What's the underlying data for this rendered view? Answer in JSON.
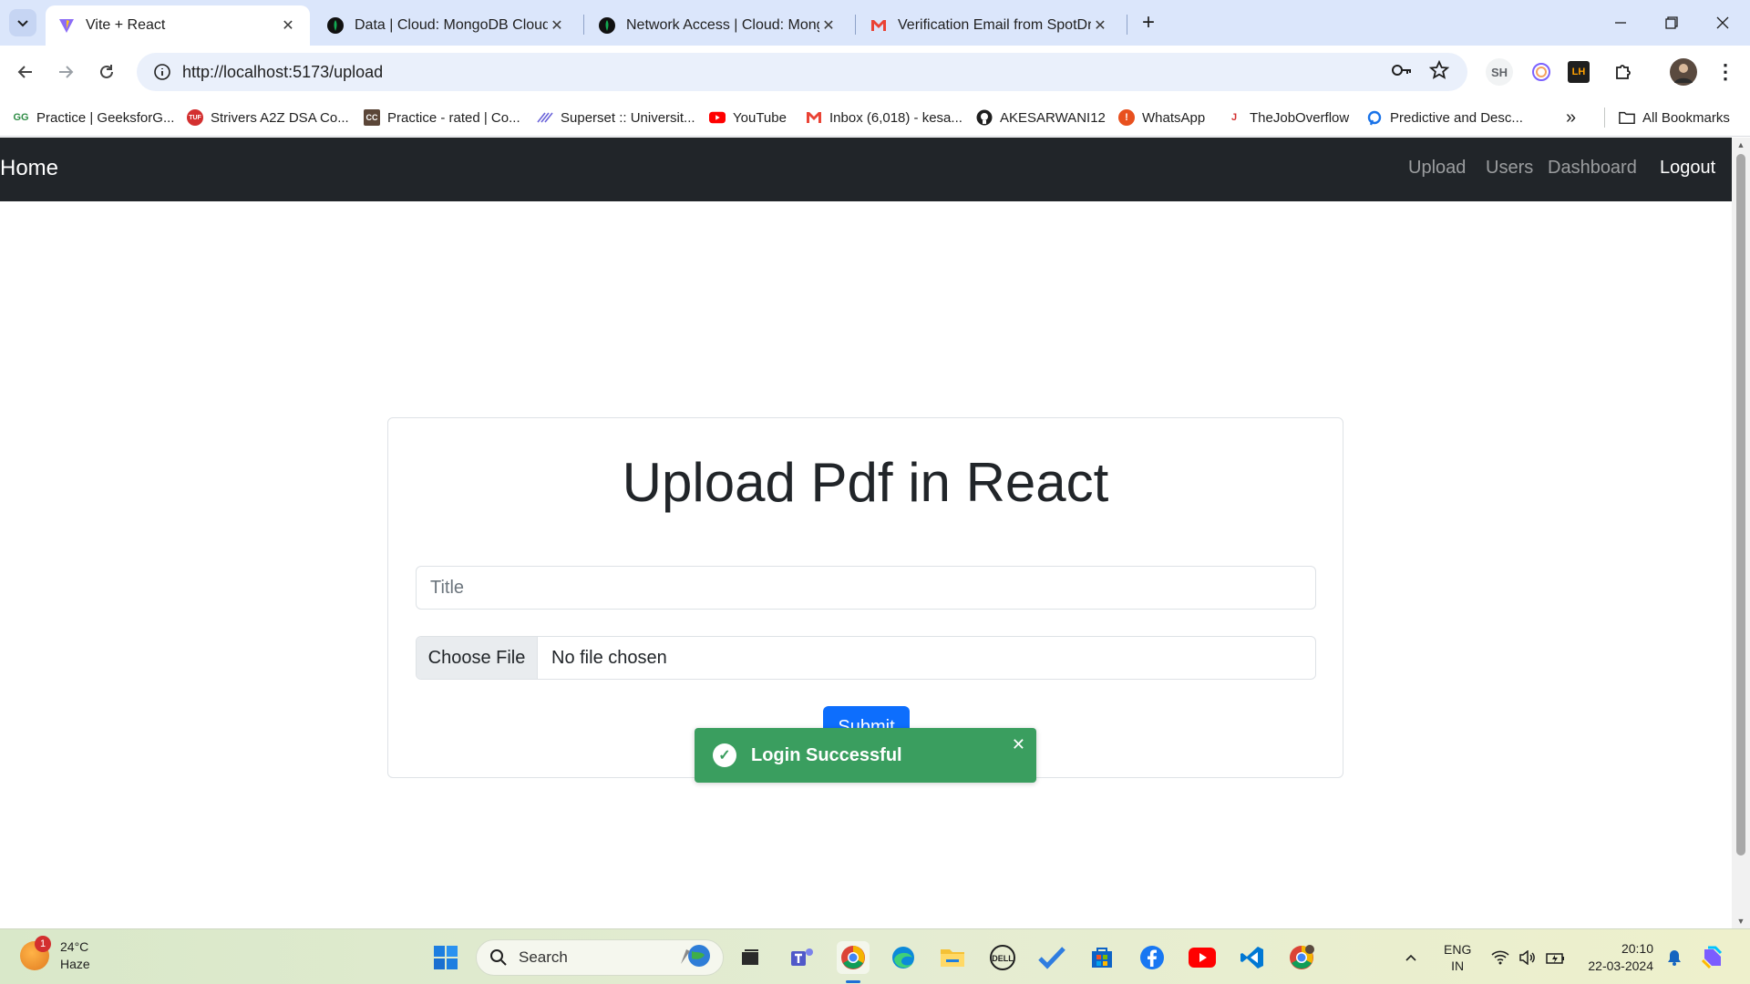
{
  "browser": {
    "tabs": [
      {
        "title": "Vite + React",
        "active": true
      },
      {
        "title": "Data | Cloud: MongoDB Cloud",
        "active": false
      },
      {
        "title": "Network Access | Cloud: Mongo",
        "active": false
      },
      {
        "title": "Verification Email from SpotDra",
        "active": false
      }
    ],
    "url": "http://localhost:5173/upload",
    "profile_ext_label": "SH",
    "ext_lh_label": "LH",
    "bookmarks": [
      {
        "label": "Practice | GeeksforG...",
        "icon": "gfg-icon"
      },
      {
        "label": "Strivers A2Z DSA Co...",
        "icon": "tuf-icon"
      },
      {
        "label": "Practice - rated | Co...",
        "icon": "codechef-icon"
      },
      {
        "label": "Superset :: Universit...",
        "icon": "superset-icon"
      },
      {
        "label": "YouTube",
        "icon": "youtube-icon"
      },
      {
        "label": "Inbox (6,018) - kesa...",
        "icon": "gmail-icon"
      },
      {
        "label": "AKESARWANI12",
        "icon": "github-icon"
      },
      {
        "label": "WhatsApp",
        "icon": "whatsapp-icon"
      },
      {
        "label": "TheJobOverflow",
        "icon": "joboverflow-icon"
      },
      {
        "label": "Predictive and Desc...",
        "icon": "predictive-icon"
      }
    ],
    "all_bookmarks_label": "All Bookmarks"
  },
  "page": {
    "navbar": {
      "brand": "Home",
      "links": [
        "Upload",
        "Users",
        "Dashboard",
        "Logout"
      ]
    },
    "form": {
      "heading": "Upload Pdf in React",
      "title_placeholder": "Title",
      "file_button_label": "Choose File",
      "file_status": "No file chosen",
      "submit_label": "Submit"
    },
    "toast": {
      "message": "Login Successful",
      "close_glyph": "✕"
    }
  },
  "taskbar": {
    "weather": {
      "temp": "24°C",
      "condition": "Haze",
      "badge": "1"
    },
    "search_label": "Search",
    "language": {
      "line1": "ENG",
      "line2": "IN"
    },
    "clock": {
      "time": "20:10",
      "date": "22-03-2024"
    }
  },
  "colors": {
    "navbar_bg": "#212529",
    "primary_button": "#0d6efd",
    "toast_bg": "#3a9e5f",
    "tabstrip_bg": "#dbe6fb"
  }
}
